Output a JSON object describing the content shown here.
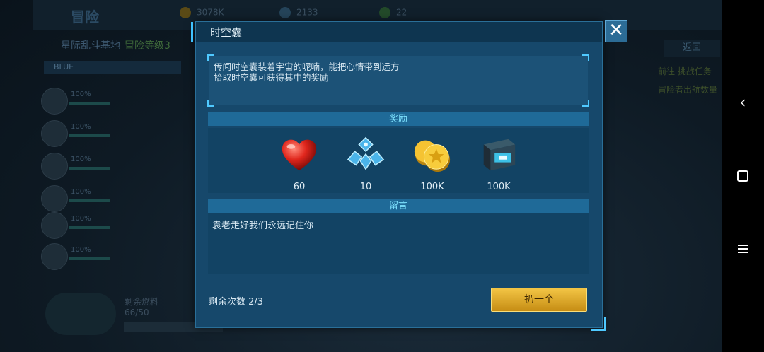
{
  "background": {
    "title": "冒险",
    "resources": [
      "3078K",
      "2133",
      "22"
    ],
    "location": "星际乱斗基地",
    "level": "冒险等级3",
    "tab_label": "BLUE",
    "crew_pct": [
      "100%",
      "100%",
      "100%",
      "100%",
      "100%",
      "100%"
    ],
    "right_button": "返回",
    "right_lines": [
      "前往 挑战任务",
      "冒险者出航数量"
    ],
    "remaining_fuel_label": "剩余燃料",
    "remaining_fuel_value": "66/50"
  },
  "dialog": {
    "title": "时空囊",
    "description": [
      "传闻时空囊装着宇宙的呢喃，能把心情带到远方",
      "拾取时空囊可获得其中的奖励"
    ],
    "rewards_header": "奖励",
    "rewards": [
      {
        "icon": "heart-icon",
        "value": "60"
      },
      {
        "icon": "crystal-icon",
        "value": "10"
      },
      {
        "icon": "gold-coin-icon",
        "value": "100K"
      },
      {
        "icon": "tech-crate-icon",
        "value": "100K"
      }
    ],
    "message_header": "留言",
    "message": "袁老走好我们永远记住你",
    "remaining_label": "剩余次数 2/3",
    "throw_button": "扔一个"
  },
  "colors": {
    "dialog_bg": "#16486b",
    "accent": "#3fc2ff",
    "button_gold": "#e0a82a"
  }
}
